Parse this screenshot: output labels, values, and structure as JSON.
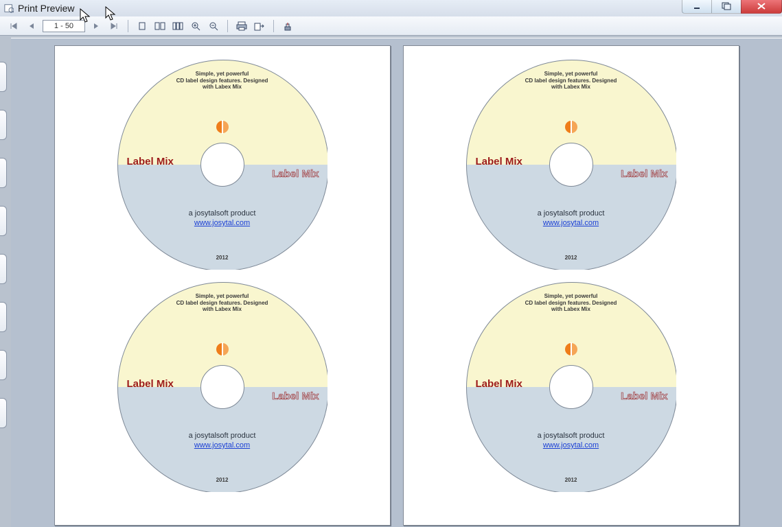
{
  "window": {
    "title": "Print Preview"
  },
  "toolbar": {
    "page_range": "1 - 50"
  },
  "label": {
    "blurb_l1": "Simple, yet powerful",
    "blurb_l2": "CD label design features. Designed",
    "blurb_l3": "with Labex Mix",
    "brand": "Label Mix",
    "company": "a josytalsoft product",
    "url_text": "www.josytal.com",
    "year": "2012"
  }
}
